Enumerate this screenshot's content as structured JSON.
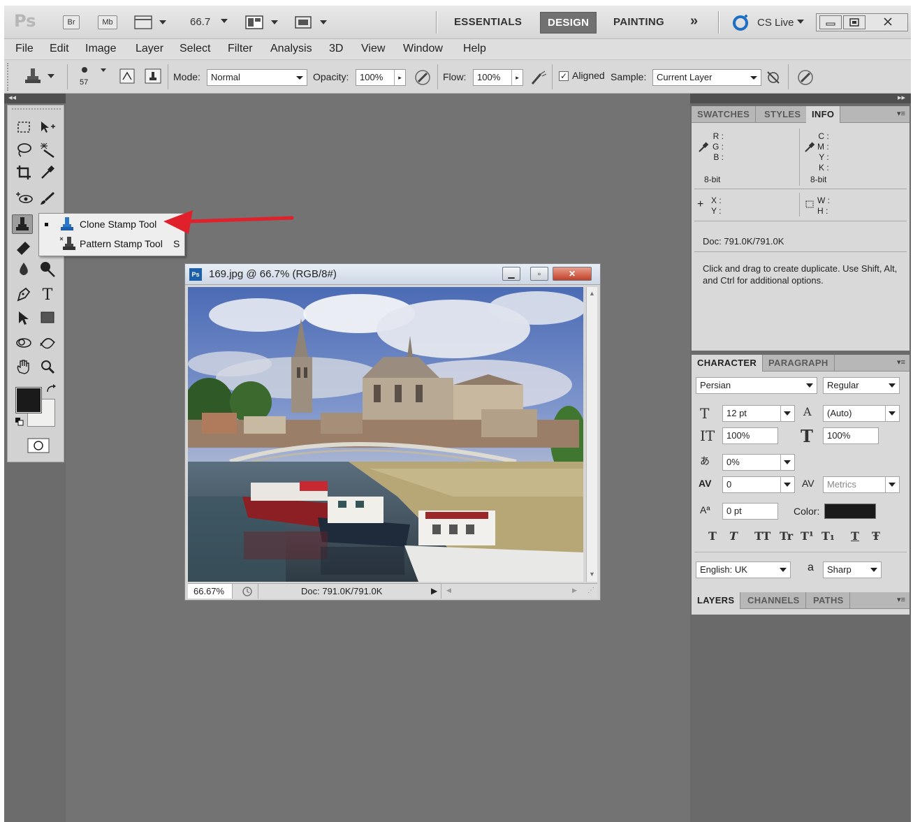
{
  "appbar": {
    "logo": "Ps",
    "bridge_label": "Br",
    "minibridge_label": "Mb",
    "zoom_value": "66.7",
    "workspaces": [
      "ESSENTIALS",
      "DESIGN",
      "PAINTING"
    ],
    "more_label": "»",
    "cslive_label": "CS Live"
  },
  "menu": [
    "File",
    "Edit",
    "Image",
    "Layer",
    "Select",
    "Filter",
    "Analysis",
    "3D",
    "View",
    "Window",
    "Help"
  ],
  "options": {
    "brush_size": "57",
    "mode_label": "Mode:",
    "mode_value": "Normal",
    "opacity_label": "Opacity:",
    "opacity_value": "100%",
    "flow_label": "Flow:",
    "flow_value": "100%",
    "aligned_label": "Aligned",
    "aligned_checked": true,
    "sample_label": "Sample:",
    "sample_value": "Current Layer"
  },
  "flyout": {
    "items": [
      {
        "label": "Clone Stamp Tool",
        "shortcut": "",
        "selected": true
      },
      {
        "label": "Pattern Stamp Tool",
        "shortcut": "S",
        "selected": false
      }
    ]
  },
  "document": {
    "title": "169.jpg @ 66.7% (RGB/8#)",
    "zoom": "66.67%",
    "doc_size": "Doc: 791.0K/791.0K"
  },
  "info_panel": {
    "tabs": [
      "SWATCHES",
      "STYLES",
      "INFO"
    ],
    "rgb_labels": "R :\nG :\nB :",
    "cmyk_labels": "C :\nM :\nY :\nK :",
    "bit_left": "8-bit",
    "bit_right": "8-bit",
    "xy_labels": "X :\nY :",
    "wh_labels": "W :\nH :",
    "doc": "Doc: 791.0K/791.0K",
    "hint": "Click and drag to create duplicate.  Use Shift, Alt, and Ctrl for additional options."
  },
  "character_panel": {
    "tabs": [
      "CHARACTER",
      "PARAGRAPH"
    ],
    "font_family": "Persian",
    "font_style": "Regular",
    "size": "12 pt",
    "leading": "(Auto)",
    "vscale": "100%",
    "hscale": "100%",
    "tsume": "0%",
    "kerning": "0",
    "tracking": "Metrics",
    "baseline": "0 pt",
    "color_label": "Color:",
    "color_value": "#1a1a1a",
    "language": "English: UK",
    "aa_label": "Sharp",
    "aa_icon": "a",
    "style_buttons": [
      "T",
      "T",
      "TT",
      "Tr",
      "T¹",
      "T₁",
      "T",
      "Ŧ"
    ]
  },
  "layers_panel": {
    "tabs": [
      "LAYERS",
      "CHANNELS",
      "PATHS"
    ]
  },
  "colors": {
    "accent_red": "#e0202a",
    "design_bg": "#717171"
  }
}
